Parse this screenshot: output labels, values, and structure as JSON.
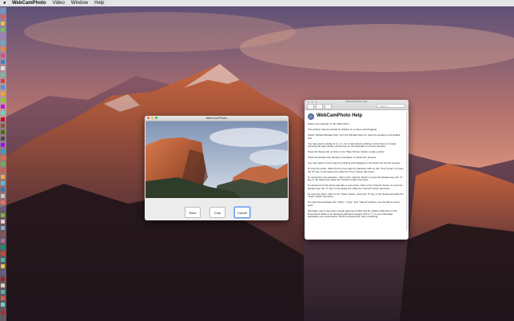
{
  "menubar": {
    "app_name": "WebCamPhoto",
    "items": [
      "Video",
      "Window",
      "Help"
    ]
  },
  "cam_window": {
    "title": "WebCamPhoto",
    "buttons": {
      "save": "Save",
      "crop": "Crop",
      "cancel": "Cancel"
    }
  },
  "help_window": {
    "title": "WebCamPhoto Help",
    "toolbar_title": "WebCamPhoto Help",
    "search_placeholder": "Search",
    "heading": "WebCamPhoto Help",
    "paragraphs": [
      "Select your webcam in the Video Menu.",
      "The window may be resized by clicking on a corner and dragging.",
      "Select \"Default Window Size\" from the Window Menu to reset the window to the default size.",
      "You may select a delay of 0, 1, 2, 3 or 4 seconds by clicking on the button or simply pressing the appropriate number key on the keyboard or numeric keypad.",
      "Press the Space bar or click on the \"Take Picture\" button to take a photo.",
      "Press the Escape key during a countdown to cancel the process.",
      "You may select a crop region by clicking and dragging on the photo but not the preview.",
      "To crop the photo, while the the crop region is selected, click on the \"Crop\" button or press the \"R\" key or the Space bar while the \"Crop\" button has focus.",
      "To cancel the crop selection, click on the \"Cancel\" button or press the Escape key, the \"C\" key or the Space bar while the \"Cancel\" button has focus.",
      "To cancel out of the photo and take a new photo, click on the \"Cancel\" button or press the Escape key, the \"C\" key or the Space bar while the \"Cancel\" button has focus.",
      "To save the photo, click on the \"Save\" button, press the \"S\" key or the Space bar while the \"Save\" button has focus.",
      "To cycle focus between the \"Save\", \"Crop\", and \"Cancel\" buttons, use the Tab or arrow keys.",
      "Filemaker users may pass a single argument which has the relative pathname to the Documents folder or an absolute pathname (begins with a \"/\"). In your Filemaker application you would add a \"Perform Applescript\" step containing:"
    ]
  },
  "colors": {
    "menubar": "#ececec",
    "focus_ring": "#6aa0e8",
    "light_red": "#fc605b",
    "light_yellow": "#fdbc40",
    "light_green": "#34c84a"
  },
  "icons": {
    "apple": "apple-icon",
    "help_app": "webcamphoto-app-icon"
  }
}
